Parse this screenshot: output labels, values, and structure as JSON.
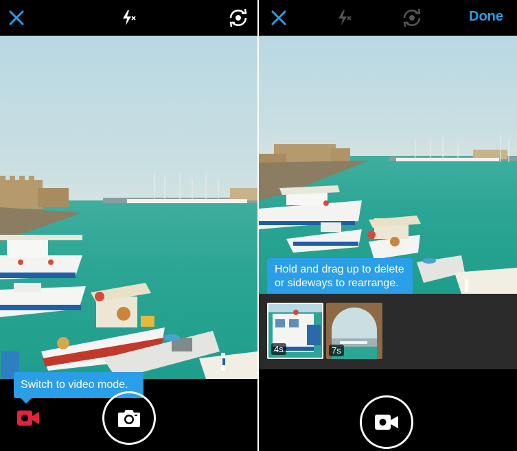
{
  "left_screen": {
    "close_icon": "close-icon",
    "flash_icon": "flash-off-icon",
    "flip_icon": "flip-camera-icon",
    "tooltip": "Switch to video mode.",
    "video_mode_icon": "video-camera-icon",
    "capture_icon": "camera-icon"
  },
  "right_screen": {
    "done_label": "Done",
    "tooltip_line1": "Hold and drag up to delete",
    "tooltip_line2": "or sideways to rearrange.",
    "clips": [
      {
        "duration": "4s"
      },
      {
        "duration": "7s"
      }
    ],
    "capture_icon": "video-camera-icon"
  },
  "colors": {
    "accent": "#2a9ee6",
    "record_red": "#e0243c",
    "sea": "#2ba594"
  }
}
